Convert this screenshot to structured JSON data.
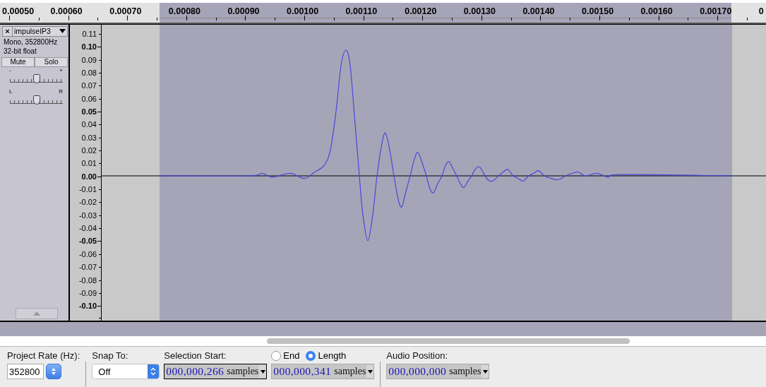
{
  "ruler": {
    "labels": [
      "0.00050",
      "0.00060",
      "0.00070",
      "0.00080",
      "0.00090",
      "0.00100",
      "0.00110",
      "0.00120",
      "0.00130",
      "0.00140",
      "0.00150",
      "0.00160",
      "0.00170",
      "0"
    ]
  },
  "track": {
    "close": "×",
    "name": "impulseIP3",
    "info": [
      "Mono, 352800Hz",
      "32-bit float"
    ],
    "mute": {
      "label": "Mute",
      "on": false
    },
    "solo": {
      "label": "Solo",
      "on": false
    },
    "gain": {
      "min": "-",
      "max": "+",
      "level": 0.5
    },
    "pan": {
      "min": "L",
      "max": "R",
      "level": 0.5
    }
  },
  "amplitude_ruler": [
    {
      "label": "0.11",
      "major": false
    },
    {
      "label": "0.10",
      "major": true
    },
    {
      "label": "0.09",
      "major": false
    },
    {
      "label": "0.08",
      "major": false
    },
    {
      "label": "0.07",
      "major": false
    },
    {
      "label": "0.06",
      "major": false
    },
    {
      "label": "0.05",
      "major": true
    },
    {
      "label": "0.04",
      "major": false
    },
    {
      "label": "0.03",
      "major": false
    },
    {
      "label": "0.02",
      "major": false
    },
    {
      "label": "0.01",
      "major": false
    },
    {
      "label": "0.00",
      "major": true
    },
    {
      "label": "-0.01",
      "major": false
    },
    {
      "label": "-0.02",
      "major": false
    },
    {
      "label": "-0.03",
      "major": false
    },
    {
      "label": "-0.04",
      "major": false
    },
    {
      "label": "-0.05",
      "major": true
    },
    {
      "label": "-0.06",
      "major": false
    },
    {
      "label": "-0.07",
      "major": false
    },
    {
      "label": "-0.08",
      "major": false
    },
    {
      "label": "-0.09",
      "major": false
    },
    {
      "label": "-0.10",
      "major": true
    }
  ],
  "toolbar": {
    "project_rate": {
      "label": "Project Rate (Hz):",
      "value": "352800"
    },
    "snap_to": {
      "label": "Snap To:",
      "value": "Off"
    },
    "selection_start": {
      "label": "Selection Start:",
      "value": "000,000,266",
      "unit": "samples"
    },
    "end_mode": [
      {
        "label": "End",
        "selected": false
      },
      {
        "label": "Length",
        "selected": true
      }
    ],
    "selection_length": {
      "value": "000,000,341",
      "unit": "samples"
    },
    "audio_position": {
      "label": "Audio Position:",
      "value": "000,000,000",
      "unit": "samples"
    }
  }
}
